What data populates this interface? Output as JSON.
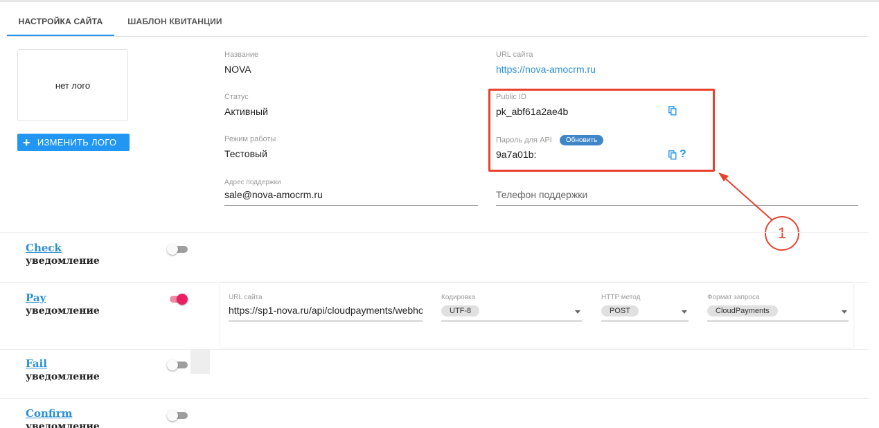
{
  "tabs": [
    {
      "label": "НАСТРОЙКА САЙТА",
      "active": true
    },
    {
      "label": "ШАБЛОН КВИТАНЦИИ",
      "active": false
    }
  ],
  "logo": {
    "placeholder_text": "нет лого",
    "change_button": "ИЗМЕНИТЬ ЛОГО"
  },
  "site": {
    "name_label": "Название",
    "name_value": "NOVA",
    "url_label": "URL сайта",
    "url_value": "https://nova-amocrm.ru",
    "status_label": "Статус",
    "status_value": "Активный",
    "public_id_label": "Public ID",
    "public_id_value": "pk_abf61a2ae4b",
    "mode_label": "Режим работы",
    "mode_value": "Тестовый",
    "api_password_label": "Пароль для API",
    "api_password_refresh": "Обновить",
    "api_password_value": "9a7a01b:",
    "support_email_label": "Адрес поддержки",
    "support_email_value": "sale@nova-amocrm.ru",
    "support_phone_placeholder": "Телефон поддержки"
  },
  "annotation": {
    "number": "1",
    "color": "#e8412c"
  },
  "notifications": [
    {
      "name": "Check",
      "sub": "уведомление",
      "enabled": false
    },
    {
      "name": "Pay",
      "sub": "уведомление",
      "enabled": true
    },
    {
      "name": "Fail",
      "sub": "уведомление",
      "enabled": false
    },
    {
      "name": "Confirm",
      "sub": "уведомление",
      "enabled": false
    }
  ],
  "pay_settings": {
    "url_label": "URL сайта",
    "url_value": "https://sp1-nova.ru/api/cloudpayments/webho",
    "encoding_label": "Кодировка",
    "encoding_value": "UTF-8",
    "method_label": "HTTP метод",
    "method_value": "POST",
    "format_label": "Формат запроса",
    "format_value": "CloudPayments"
  },
  "colors": {
    "accent": "#2196f3",
    "link": "#2a8fd6",
    "toggle_on": "#e91e63",
    "annotation": "#e8412c"
  }
}
